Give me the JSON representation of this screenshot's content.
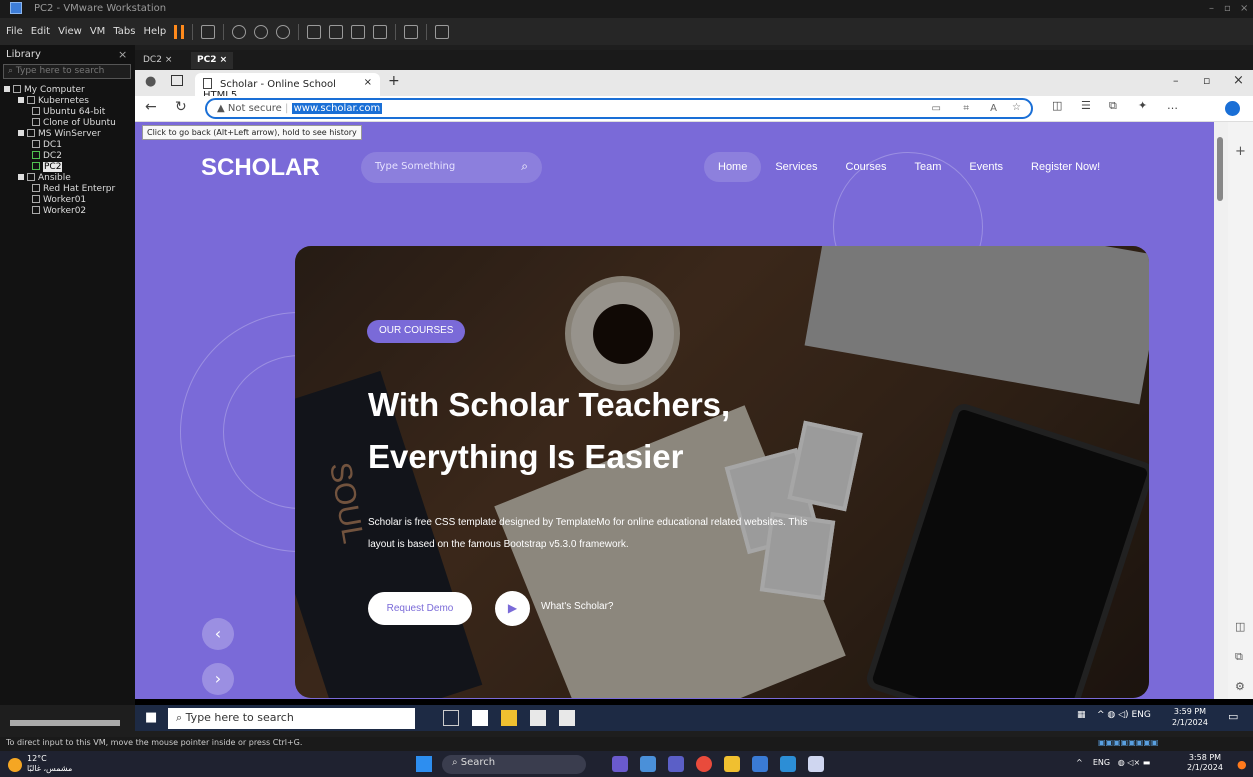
{
  "vmware": {
    "title": "PC2 - VMware Workstation",
    "menu": [
      "File",
      "Edit",
      "View",
      "VM",
      "Tabs",
      "Help"
    ],
    "library_title": "Library",
    "library_search_placeholder": "Type here to search",
    "tree": [
      {
        "label": "My Computer",
        "level": 0,
        "kind": "root"
      },
      {
        "label": "Kubernetes",
        "level": 1,
        "kind": "folder"
      },
      {
        "label": "Ubuntu 64-bit",
        "level": 2,
        "kind": "vm"
      },
      {
        "label": "Clone of Ubuntu",
        "level": 2,
        "kind": "vm"
      },
      {
        "label": "MS WinServer",
        "level": 1,
        "kind": "folder"
      },
      {
        "label": "DC1",
        "level": 2,
        "kind": "vm"
      },
      {
        "label": "DC2",
        "level": 2,
        "kind": "vm-on"
      },
      {
        "label": "PC2",
        "level": 2,
        "kind": "vm-on",
        "selected": true
      },
      {
        "label": "Ansible",
        "level": 1,
        "kind": "folder"
      },
      {
        "label": "Red Hat Enterpr",
        "level": 2,
        "kind": "vm"
      },
      {
        "label": "Worker01",
        "level": 2,
        "kind": "vm"
      },
      {
        "label": "Worker02",
        "level": 2,
        "kind": "vm"
      }
    ],
    "vm_tabs": [
      "DC2",
      "PC2"
    ],
    "active_vm_tab": "PC2",
    "status_text": "To direct input to this VM, move the mouse pointer inside or press Ctrl+G."
  },
  "browser": {
    "tab_title": "Scholar - Online School HTML5",
    "not_secure": "Not secure",
    "url": "www.scholar.com",
    "tooltip": "Click to go back (Alt+Left arrow), hold to see history"
  },
  "site": {
    "logo": "SCHOLAR",
    "search_placeholder": "Type Something",
    "nav": [
      "Home",
      "Services",
      "Courses",
      "Team",
      "Events",
      "Register Now!"
    ],
    "active_nav": "Home",
    "badge": "OUR COURSES",
    "headline_1": "With Scholar Teachers,",
    "headline_2": "Everything Is Easier",
    "description": "Scholar is free CSS template designed by TemplateMo for online educational related websites. This layout is based on the famous Bootstrap v5.3.0 framework.",
    "request_demo": "Request Demo",
    "whats_scholar": "What's Scholar?",
    "hero_book_text": "SOUL",
    "accent_color": "#7a6ad8"
  },
  "guest_taskbar": {
    "search_placeholder": "Type here to search",
    "lang": "ENG",
    "time": "3:59 PM",
    "date": "2/1/2024"
  },
  "host_taskbar": {
    "temp": "12°C",
    "weather": "مشمس، غالبًا",
    "search": "Search",
    "lang": "ENG",
    "time": "3:58 PM",
    "date": "2/1/2024"
  }
}
